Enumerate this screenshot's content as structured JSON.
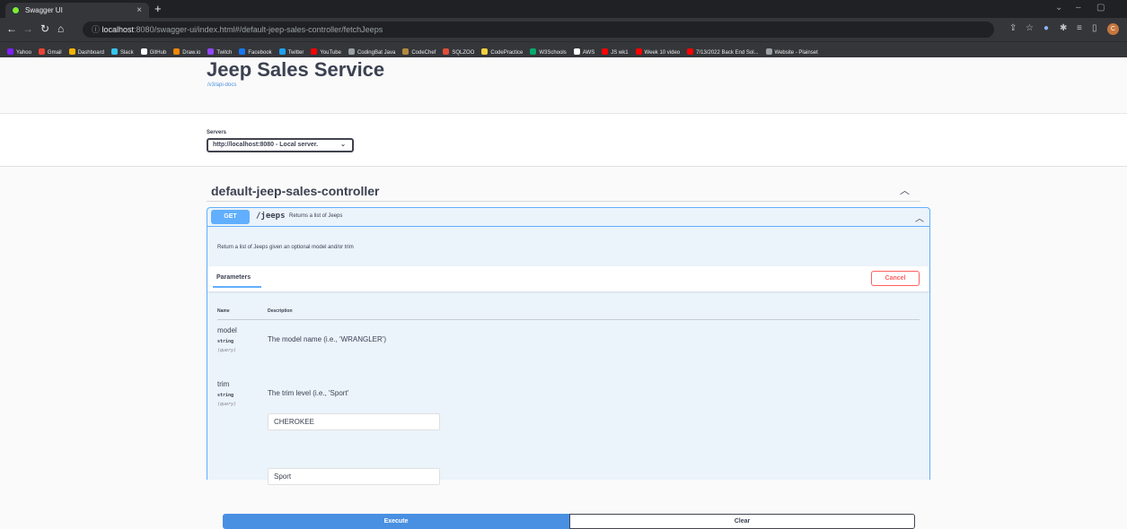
{
  "browser": {
    "tab_title": "Swagger UI",
    "tab_close": "×",
    "new_tab": "+",
    "url_host": "localhost",
    "url_rest": ":8080/swagger-ui/index.html#/default-jeep-sales-controller/fetchJeeps",
    "bookmarks": [
      {
        "label": "Yahoo",
        "color": "#7e1fff"
      },
      {
        "label": "Gmail",
        "color": "#ea4335"
      },
      {
        "label": "Dashboard",
        "color": "#f4b400"
      },
      {
        "label": "Slack",
        "color": "#36c5f0"
      },
      {
        "label": "GitHub",
        "color": "#ffffff"
      },
      {
        "label": "Draw.io",
        "color": "#f08705"
      },
      {
        "label": "Twitch",
        "color": "#9146ff"
      },
      {
        "label": "Facebook",
        "color": "#1877f2"
      },
      {
        "label": "Twitter",
        "color": "#1da1f2"
      },
      {
        "label": "YouTube",
        "color": "#ff0000"
      },
      {
        "label": "CodingBat Java",
        "color": "#9aa0a6"
      },
      {
        "label": "CodeChef",
        "color": "#b38a3d"
      },
      {
        "label": "SQLZOO",
        "color": "#e04e39"
      },
      {
        "label": "CodePractice",
        "color": "#f4d03f"
      },
      {
        "label": "W3Schools",
        "color": "#04aa6d"
      },
      {
        "label": "AWS",
        "color": "#ffffff"
      },
      {
        "label": "JS wk1",
        "color": "#ff0000"
      },
      {
        "label": "Week 10 video",
        "color": "#ff0000"
      },
      {
        "label": "7/13/2022 Back End Sol...",
        "color": "#ff0000"
      },
      {
        "label": "Website - Plainset",
        "color": "#9aa0a6"
      }
    ]
  },
  "info": {
    "title": "Jeep Sales Service",
    "api_docs_link": "/v3/api-docs"
  },
  "servers": {
    "label": "Servers",
    "selected": "http://localhost:8080 - Local server."
  },
  "tag": {
    "name": "default-jeep-sales-controller"
  },
  "operation": {
    "method": "GET",
    "path": "/jeeps",
    "summary": "Returns a list of Jeeps",
    "description": "Return a list of Jeeps given an optional model and/or trim",
    "parameters_tab": "Parameters",
    "cancel_label": "Cancel",
    "col_name": "Name",
    "col_description": "Description",
    "params": [
      {
        "name": "model",
        "type": "string",
        "in": "(query)",
        "description": "The model name (i.e., 'WRANGLER')",
        "value": "CHEROKEE"
      },
      {
        "name": "trim",
        "type": "string",
        "in": "(query)",
        "description": "The trim level (i.e., 'Sport'",
        "value": "Sport"
      }
    ],
    "execute_label": "Execute",
    "clear_label": "Clear"
  },
  "colors": {
    "get_accent": "#61affe",
    "execute": "#4990e2",
    "cancel": "#ff6060",
    "text": "#3b4151"
  }
}
